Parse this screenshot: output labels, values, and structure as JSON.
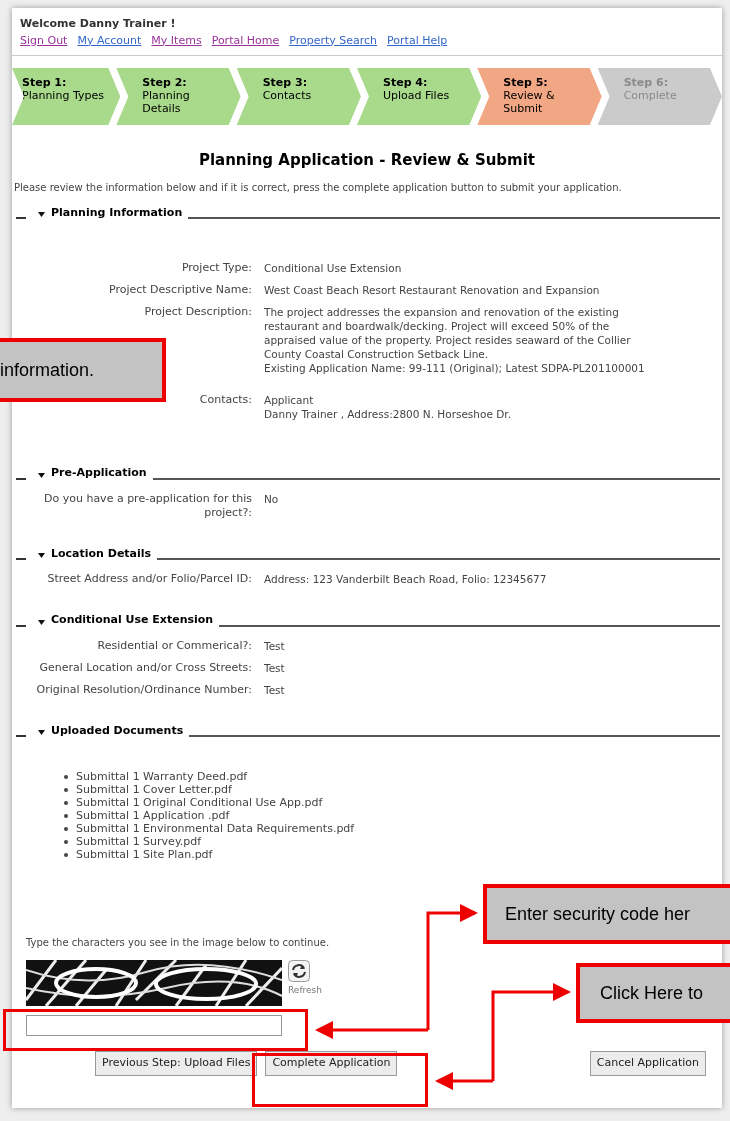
{
  "header": {
    "welcome": "Welcome Danny Trainer !",
    "links": [
      {
        "label": "Sign Out",
        "visited": true
      },
      {
        "label": "My Account",
        "visited": false
      },
      {
        "label": "My Items",
        "visited": true
      },
      {
        "label": "Portal Home",
        "visited": true
      },
      {
        "label": "Property Search",
        "visited": false
      },
      {
        "label": "Portal Help",
        "visited": false
      }
    ]
  },
  "steps": [
    {
      "number": "Step 1:",
      "label": "Planning Types",
      "completed": true,
      "selected": false
    },
    {
      "number": "Step 2:",
      "label": "Planning Details",
      "completed": true,
      "selected": false
    },
    {
      "number": "Step 3:",
      "label": "Contacts",
      "completed": true,
      "selected": false
    },
    {
      "number": "Step 4:",
      "label": "Upload Files",
      "completed": true,
      "selected": false
    },
    {
      "number": "Step 5:",
      "label": "Review & Submit",
      "completed": false,
      "selected": true
    },
    {
      "number": "Step 6:",
      "label": "Complete",
      "completed": false,
      "selected": false
    }
  ],
  "title": "Planning Application - Review & Submit",
  "intro": "Please review the information below and if it is correct, press the complete application button to submit your application.",
  "sections": [
    {
      "title": "Planning Information",
      "expanded": true,
      "fields": [
        {
          "label": "Project Type:",
          "value": "Conditional Use Extension"
        },
        {
          "label": "Project Descriptive Name:",
          "value": "West Coast Beach Resort Restaurant Renovation and Expansion"
        },
        {
          "label": "Project Description:",
          "value": "The project addresses the expansion and renovation of the existing restaurant and boardwalk/decking. Project will exceed 50% of the appraised value of the property. Project resides seaward of the Collier County Coastal Construction Setback Line.\nExisting Application Name: 99-111 (Original); Latest SDPA-PL201100001"
        },
        {
          "label": "Contacts:",
          "value": "Applicant\nDanny Trainer , Address:2800 N. Horseshoe Dr."
        }
      ]
    },
    {
      "title": "Pre-Application",
      "expanded": true,
      "fields": [
        {
          "label": "Do you have a pre-application for this project?:",
          "value": "No"
        }
      ]
    },
    {
      "title": "Location Details",
      "expanded": true,
      "fields": [
        {
          "label": "Street Address and/or Folio/Parcel ID:",
          "value": "Address: 123 Vanderbilt Beach Road, Folio: 12345677"
        }
      ]
    },
    {
      "title": "Conditional Use Extension",
      "expanded": true,
      "fields": [
        {
          "label": "Residential or Commerical?:",
          "value": "Test"
        },
        {
          "label": "General Location and/or Cross Streets:",
          "value": "Test"
        },
        {
          "label": "Original Resolution/Ordinance Number:",
          "value": "Test"
        }
      ]
    },
    {
      "title": "Uploaded Documents",
      "expanded": true,
      "documents": [
        "Submittal 1 Warranty Deed.pdf",
        "Submittal 1 Cover Letter.pdf",
        "Submittal 1 Original Conditional Use App.pdf",
        "Submittal 1 Application .pdf",
        "Submittal 1 Environmental Data Requirements.pdf",
        "Submittal 1 Survey.pdf",
        "Submittal 1 Site Plan.pdf"
      ]
    }
  ],
  "captcha": {
    "prompt": "Type the characters you see in the image below to continue.",
    "refresh": "Refresh"
  },
  "buttons": [
    {
      "label": "Previous Step: Upload Files"
    },
    {
      "label": "Complete Application"
    },
    {
      "label": "Cancel Application"
    }
  ],
  "callouts": [
    "information.",
    "Enter security code her",
    "Click Here to"
  ]
}
